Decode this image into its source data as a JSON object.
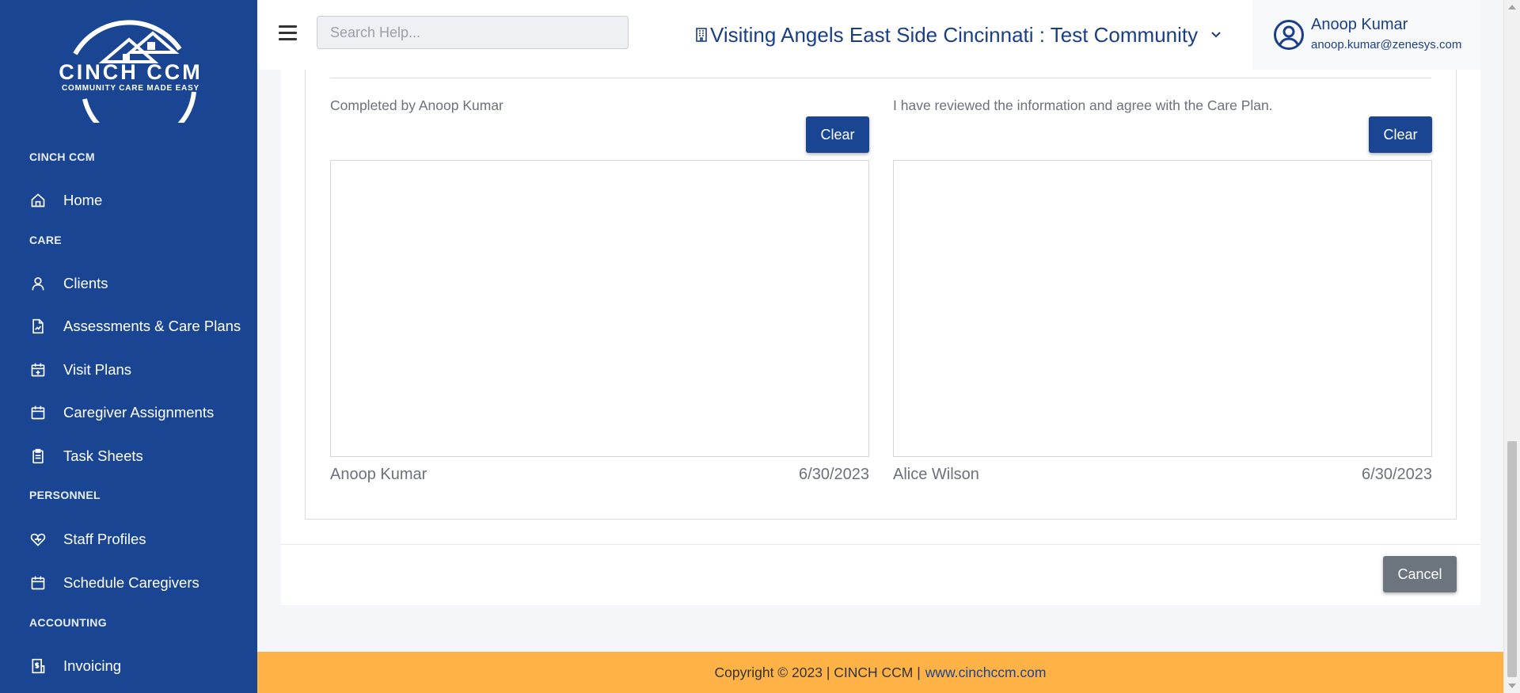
{
  "sidebar": {
    "logo": {
      "title": "CINCH CCM",
      "tagline": "COMMUNITY CARE MADE EASY"
    },
    "sections": [
      {
        "label": "CINCH CCM"
      },
      {
        "label": "CARE"
      },
      {
        "label": "PERSONNEL"
      },
      {
        "label": "ACCOUNTING"
      }
    ],
    "items": [
      {
        "label": "Home",
        "icon": "home-icon"
      },
      {
        "label": "Clients",
        "icon": "user-icon"
      },
      {
        "label": "Assessments & Care Plans",
        "icon": "document-chart-icon"
      },
      {
        "label": "Visit Plans",
        "icon": "calendar-plus-icon"
      },
      {
        "label": "Caregiver Assignments",
        "icon": "calendar-icon"
      },
      {
        "label": "Task Sheets",
        "icon": "clipboard-icon"
      },
      {
        "label": "Staff Profiles",
        "icon": "heart-pulse-icon"
      },
      {
        "label": "Schedule Caregivers",
        "icon": "calendar-icon"
      },
      {
        "label": "Invoicing",
        "icon": "invoice-dollar-icon"
      }
    ]
  },
  "header": {
    "search": {
      "placeholder": "Search Help...",
      "value": ""
    },
    "community": "Visiting Angels East Side Cincinnati : Test Community",
    "user": {
      "name": "Anoop Kumar",
      "email": "anoop.kumar@zenesys.com"
    }
  },
  "signatures": [
    {
      "caption": "Completed by Anoop Kumar",
      "clear_label": "Clear",
      "name": "Anoop Kumar",
      "date": "6/30/2023"
    },
    {
      "caption": "I have reviewed the information and agree with the Care Plan.",
      "clear_label": "Clear",
      "name": "Alice Wilson",
      "date": "6/30/2023"
    }
  ],
  "actions": {
    "cancel_label": "Cancel"
  },
  "footer": {
    "text": "Copyright © 2023 | CINCH CCM |",
    "link": "www.cinchccm.com"
  },
  "colors": {
    "sidebar": "#1a4592",
    "primary": "#1a4592",
    "footer": "#ffb347",
    "cancel": "#6c757d"
  }
}
